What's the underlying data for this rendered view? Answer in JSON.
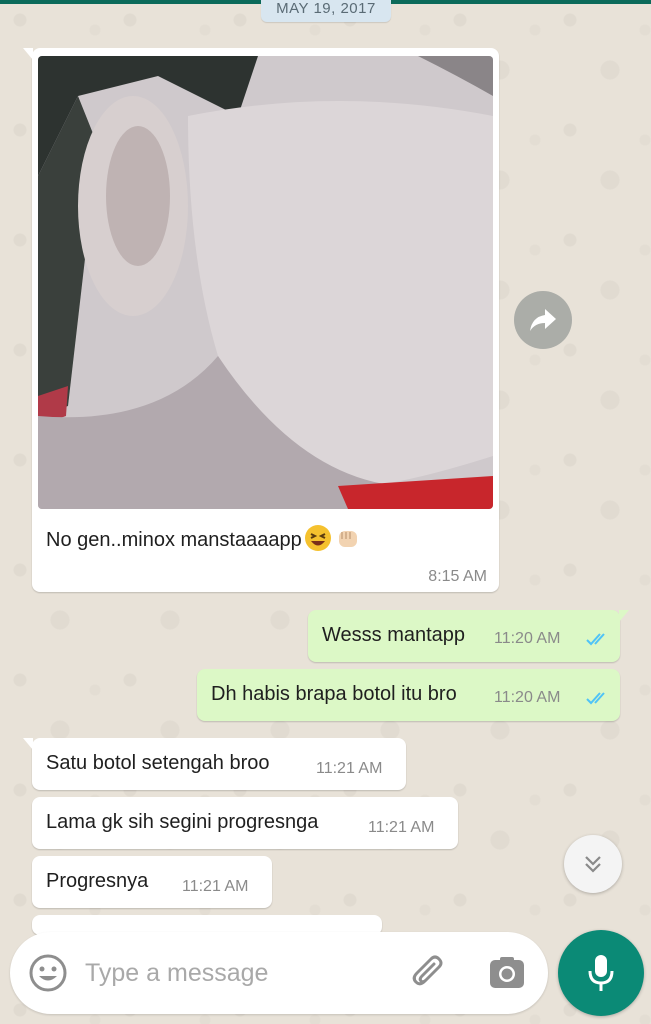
{
  "date_chip": "MAY 19, 2017",
  "messages": [
    {
      "direction": "incoming",
      "type": "image",
      "caption": "No gen..minox manstaaaapp",
      "time": "8:15 AM"
    },
    {
      "direction": "outgoing",
      "text": "Wesss mantapp",
      "time": "11:20 AM",
      "status": "read"
    },
    {
      "direction": "outgoing",
      "text": "Dh habis brapa botol itu bro",
      "time": "11:20 AM",
      "status": "read"
    },
    {
      "direction": "incoming",
      "text": "Satu botol setengah broo",
      "time": "11:21 AM"
    },
    {
      "direction": "incoming",
      "text": "Lama gk sih segini progresnga",
      "time": "11:21 AM"
    },
    {
      "direction": "incoming",
      "text": "Progresnya",
      "time": "11:21 AM"
    }
  ],
  "caption_emojis": [
    "laughing-face-icon",
    "fist-bump-icon"
  ],
  "composer": {
    "placeholder": "Type a message",
    "icons": [
      "emoji-icon",
      "paperclip-icon",
      "camera-icon",
      "microphone-icon"
    ]
  },
  "colors": {
    "outgoing_bubble": "#dcf8c6",
    "incoming_bubble": "#ffffff",
    "read_ticks": "#4fc3f7",
    "mic_button": "#0b8a76"
  }
}
